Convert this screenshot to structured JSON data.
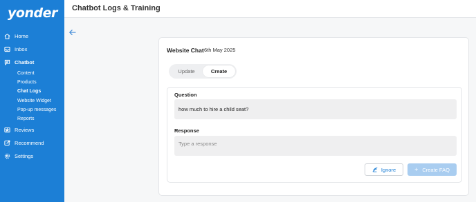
{
  "sidebar": {
    "logo": "yonder",
    "items": [
      {
        "label": "Home",
        "icon": "home-icon"
      },
      {
        "label": "Inbox",
        "icon": "inbox-icon"
      },
      {
        "label": "Chatbot",
        "icon": "chatbot-icon"
      },
      {
        "label": "Reviews",
        "icon": "reviews-icon"
      },
      {
        "label": "Recommend",
        "icon": "recommend-icon"
      },
      {
        "label": "Settings",
        "icon": "settings-icon"
      }
    ],
    "chatbot_sub": [
      "Content",
      "Products",
      "Chat Logs",
      "Website Widget",
      "Pop-up messages",
      "Reports"
    ]
  },
  "header": {
    "title": "Chatbot Logs & Training"
  },
  "card": {
    "title": "Website Chat",
    "date": "6th May 2025",
    "tabs": [
      "Update",
      "Create"
    ],
    "active_tab": "Create",
    "question_label": "Question",
    "question_value": "how much to hire a child seat?",
    "response_label": "Response",
    "response_placeholder": "Type a response",
    "ignore_label": "Ignore",
    "create_label": "Create FAQ"
  },
  "colors": {
    "sidebar": "#1c7fd6",
    "accent": "#1c7fd6",
    "create_disabled": "#a9cdf0"
  }
}
